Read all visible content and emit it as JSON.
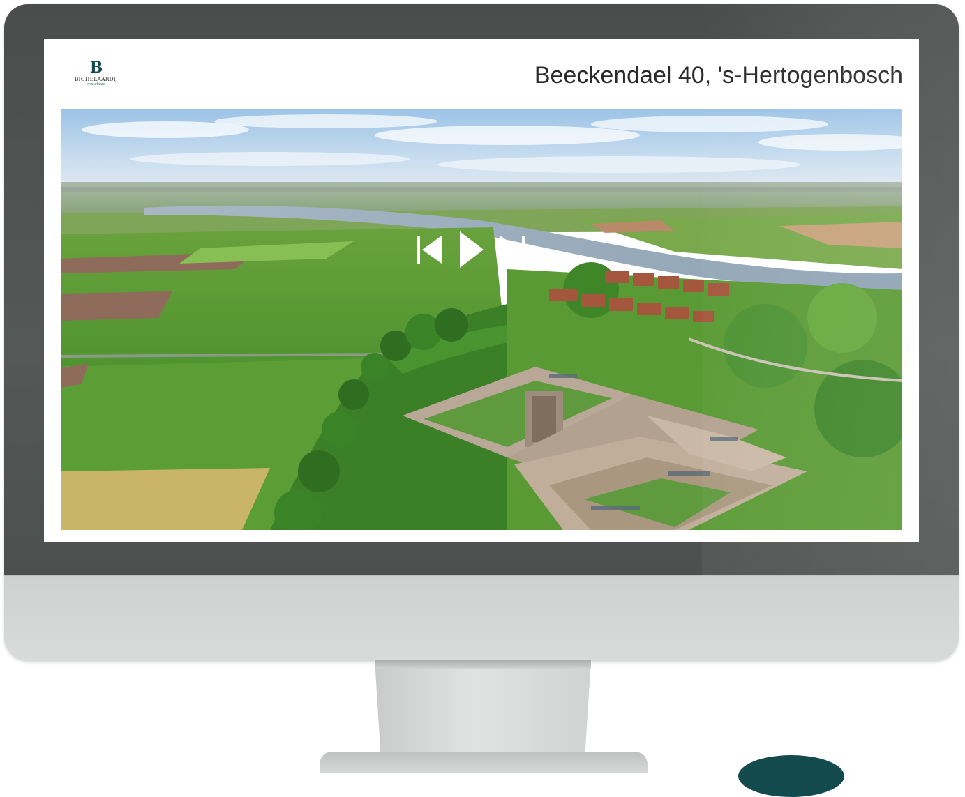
{
  "header": {
    "logo_mark": "B",
    "logo_name": "BIGHELAARDIJ",
    "logo_sub": "makelaars",
    "title": "Beeckendael 40, 's-Hertogenbosch"
  },
  "photo": {
    "content": "aerial-landscape-with-river-and-apartment-complex"
  },
  "player": {
    "controls": [
      "previous-icon",
      "play-icon",
      "next-icon"
    ]
  },
  "colors": {
    "brand": "#134a4e",
    "accent": "#2e7d6f",
    "bezel": "#4d504f",
    "chin": "#d4d5d5"
  }
}
